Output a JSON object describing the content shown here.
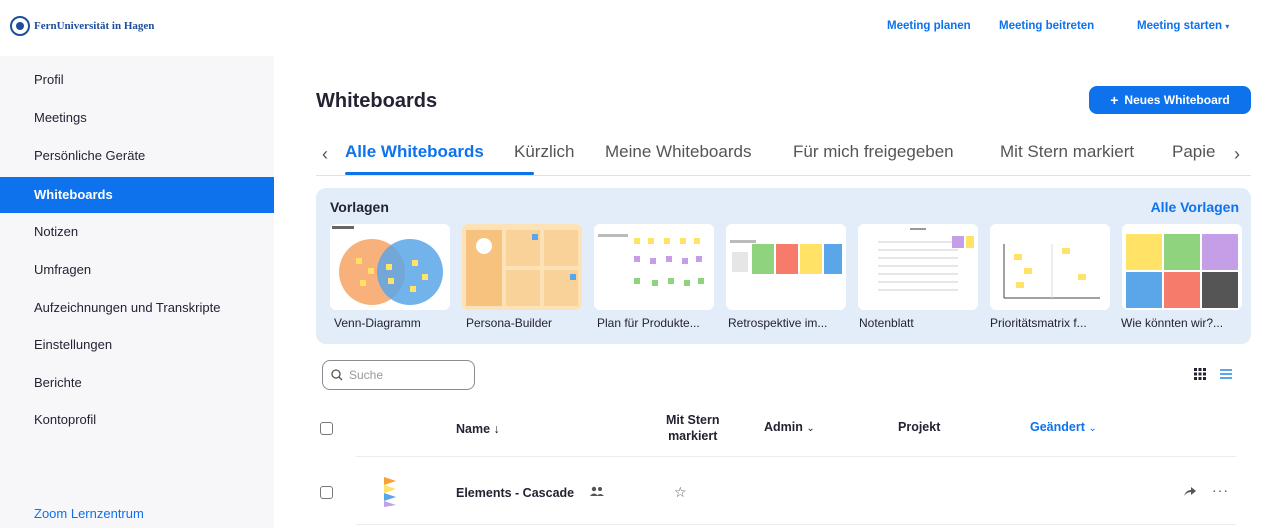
{
  "brand": {
    "name": "FernUniversität in Hagen"
  },
  "header": {
    "links": [
      "Meeting planen",
      "Meeting beitreten"
    ],
    "start_meeting": "Meeting starten"
  },
  "sidebar": {
    "items": [
      {
        "label": "Profil"
      },
      {
        "label": "Meetings"
      },
      {
        "label": "Persönliche Geräte"
      },
      {
        "label": "Whiteboards"
      },
      {
        "label": "Notizen"
      },
      {
        "label": "Umfragen"
      },
      {
        "label": "Aufzeichnungen und Transkripte"
      },
      {
        "label": "Einstellungen"
      },
      {
        "label": "Berichte"
      },
      {
        "label": "Kontoprofil"
      }
    ],
    "active_index": 3,
    "footer_link": "Zoom Lernzentrum"
  },
  "main": {
    "title": "Whiteboards",
    "new_button": "Neues Whiteboard",
    "tabs": [
      {
        "label": "Alle Whiteboards"
      },
      {
        "label": "Kürzlich"
      },
      {
        "label": "Meine Whiteboards"
      },
      {
        "label": "Für mich freigegeben"
      },
      {
        "label": "Mit Stern markiert"
      },
      {
        "label": "Papie"
      }
    ]
  },
  "templates": {
    "heading": "Vorlagen",
    "all_link": "Alle Vorlagen",
    "cards": [
      {
        "label": "Venn-Diagramm"
      },
      {
        "label": "Persona-Builder"
      },
      {
        "label": "Plan für Produkte..."
      },
      {
        "label": "Retrospektive im..."
      },
      {
        "label": "Notenblatt"
      },
      {
        "label": "Prioritätsmatrix f..."
      },
      {
        "label": "Wie könnten wir?..."
      }
    ]
  },
  "search": {
    "placeholder": "Suche"
  },
  "table": {
    "columns": {
      "name": "Name",
      "starred_line1": "Mit Stern",
      "starred_line2": "markiert",
      "admin": "Admin",
      "project": "Projekt",
      "changed": "Geändert"
    },
    "rows": [
      {
        "name": "Elements - Cascade"
      }
    ]
  },
  "colors": {
    "accent": "#0e72ed",
    "sidebar_bg": "#f7f7fa",
    "template_bg": "#e3ecf9"
  }
}
